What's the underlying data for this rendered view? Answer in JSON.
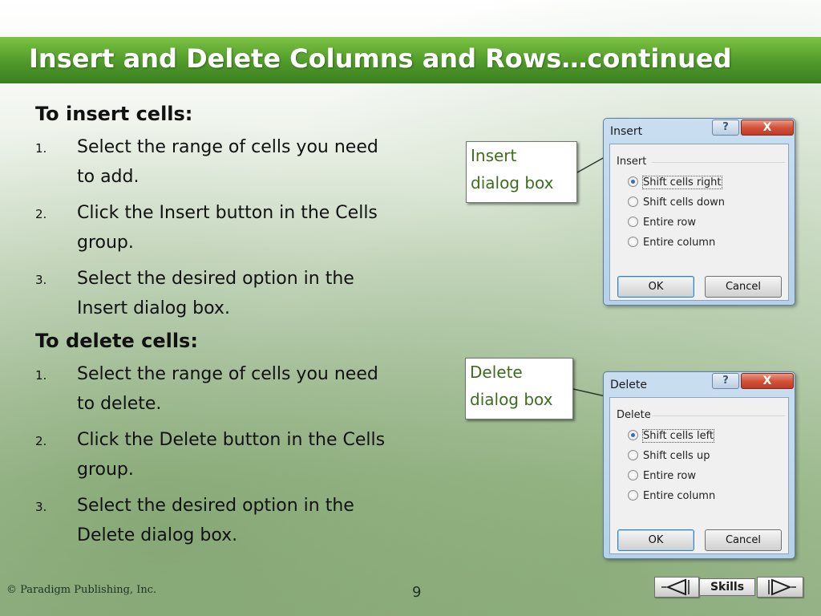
{
  "slide": {
    "title": "Insert and Delete Columns and Rows…continued"
  },
  "content": {
    "insert_heading": "To insert cells:",
    "insert_steps": [
      {
        "num": "1.",
        "line1": "Select the range of cells you need",
        "line2": "to add."
      },
      {
        "num": "2.",
        "line1": "Click the Insert button in the Cells",
        "line2": "group."
      },
      {
        "num": "3.",
        "line1": "Select the desired option in the",
        "line2": "Insert dialog box."
      }
    ],
    "delete_heading": "To delete cells:",
    "delete_steps": [
      {
        "num": "1.",
        "line1": "Select the range of cells you need",
        "line2": "to delete."
      },
      {
        "num": "2.",
        "line1": "Click the Delete button in the Cells",
        "line2": "group."
      },
      {
        "num": "3.",
        "line1": "Select the desired option in the",
        "line2": "Delete dialog box."
      }
    ]
  },
  "callouts": {
    "insert": {
      "line1": "Insert",
      "line2": "dialog box"
    },
    "delete": {
      "line1": "Delete",
      "line2": "dialog box"
    }
  },
  "insert_dialog": {
    "title": "Insert",
    "help_label": "?",
    "close_label": "X",
    "group_label": "Insert",
    "options": [
      "Shift cells right",
      "Shift cells down",
      "Entire row",
      "Entire column"
    ],
    "selected": "Shift cells right",
    "ok_label": "OK",
    "cancel_label": "Cancel"
  },
  "delete_dialog": {
    "title": "Delete",
    "help_label": "?",
    "close_label": "X",
    "group_label": "Delete",
    "options": [
      "Shift cells left",
      "Shift cells up",
      "Entire row",
      "Entire column"
    ],
    "selected": "Shift cells left",
    "ok_label": "OK",
    "cancel_label": "Cancel"
  },
  "footer": {
    "copyright": "© Paradigm Publishing, Inc.",
    "page_number": "9",
    "skills_label": "Skills",
    "prev_icon": "left-triangle-icon",
    "next_icon": "right-triangle-icon"
  },
  "colors": {
    "title_bar_green": "#4f9a2a",
    "callout_text_green": "#3c6e1e",
    "dialog_frame_blue": "#b7d1ea",
    "close_button_red": "#c23a22"
  }
}
